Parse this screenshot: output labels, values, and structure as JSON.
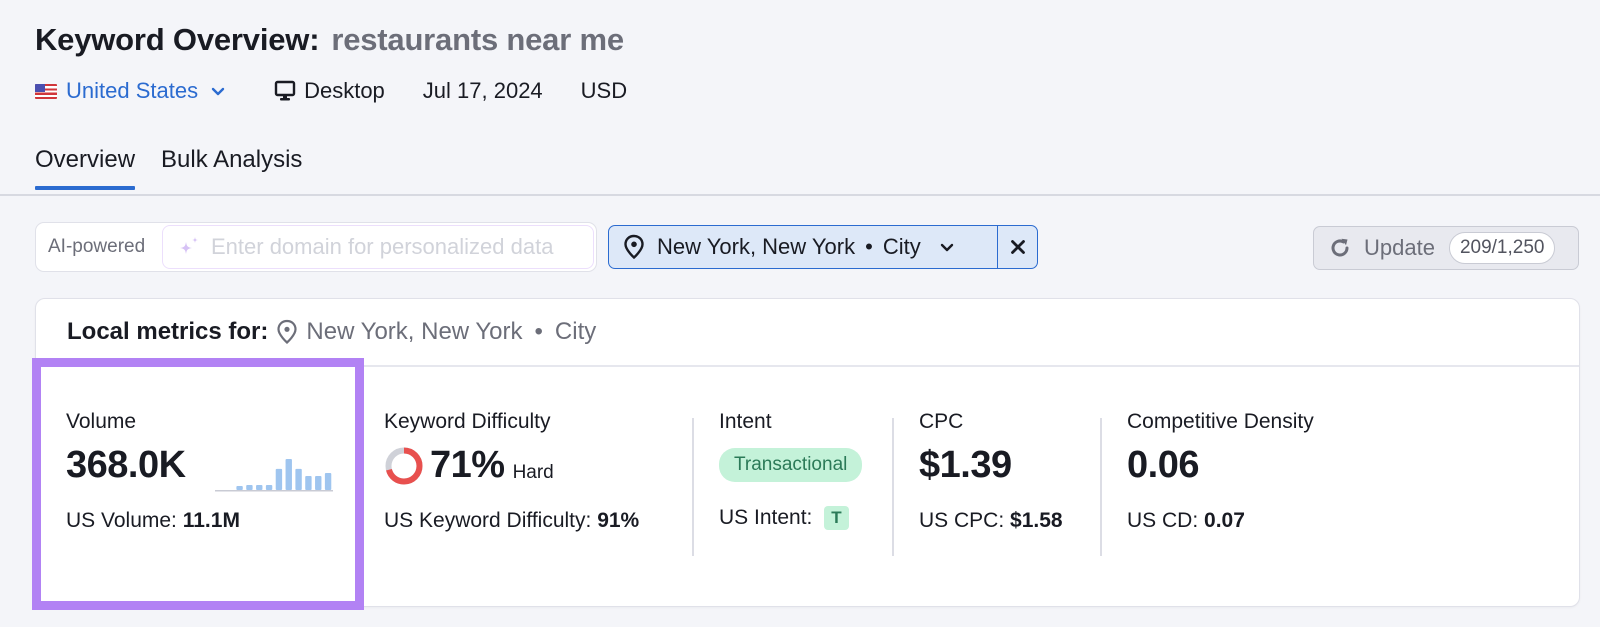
{
  "header": {
    "title": "Keyword Overview:",
    "keyword": "restaurants near me",
    "database": "United States",
    "device": "Desktop",
    "date": "Jul 17, 2024",
    "currency": "USD"
  },
  "tabs": [
    {
      "label": "Overview",
      "active": true
    },
    {
      "label": "Bulk Analysis",
      "active": false
    }
  ],
  "toolbar": {
    "ai_label": "AI-powered",
    "domain_placeholder": "Enter domain for personalized data",
    "domain_value": "",
    "location": "New York, New York",
    "location_separator": "•",
    "location_type": "City",
    "update_label": "Update",
    "update_count": "209/1,250"
  },
  "card": {
    "header_label": "Local metrics for:",
    "location": "New York, New York",
    "location_separator": "•",
    "location_type": "City"
  },
  "metrics": {
    "volume": {
      "label": "Volume",
      "value": "368.0K",
      "sub_label": "US Volume:",
      "sub_value": "11.1M",
      "trend_relative": [
        0,
        0,
        0.13,
        0.16,
        0.16,
        0.16,
        0.68,
        1.0,
        0.68,
        0.45,
        0.45,
        0.55
      ]
    },
    "kd": {
      "label": "Keyword Difficulty",
      "value": "71%",
      "percent": 71,
      "level": "Hard",
      "sub_label": "US Keyword Difficulty:",
      "sub_value": "91%"
    },
    "intent": {
      "label": "Intent",
      "value": "Transactional",
      "sub_label": "US Intent:",
      "sub_value": "T"
    },
    "cpc": {
      "label": "CPC",
      "value": "$1.39",
      "sub_label": "US CPC:",
      "sub_value": "$1.58"
    },
    "cd": {
      "label": "Competitive Density",
      "value": "0.06",
      "sub_label": "US CD:",
      "sub_value": "0.07"
    }
  },
  "colors": {
    "accent": "#2b6bd0",
    "highlight": "#b282f4",
    "kd_hard": "#e8504e",
    "kd_track": "#cfd1d8",
    "intent_bg": "#c4f2d9",
    "intent_text": "#2b7a58",
    "trend_bar": "#9fc5ef"
  },
  "icons": {
    "flag": "us-flag-icon",
    "device": "desktop-icon",
    "location": "map-pin-icon",
    "sparkle": "sparkle-icon",
    "refresh": "refresh-icon",
    "clear": "close-icon",
    "chevron": "chevron-down-icon"
  }
}
